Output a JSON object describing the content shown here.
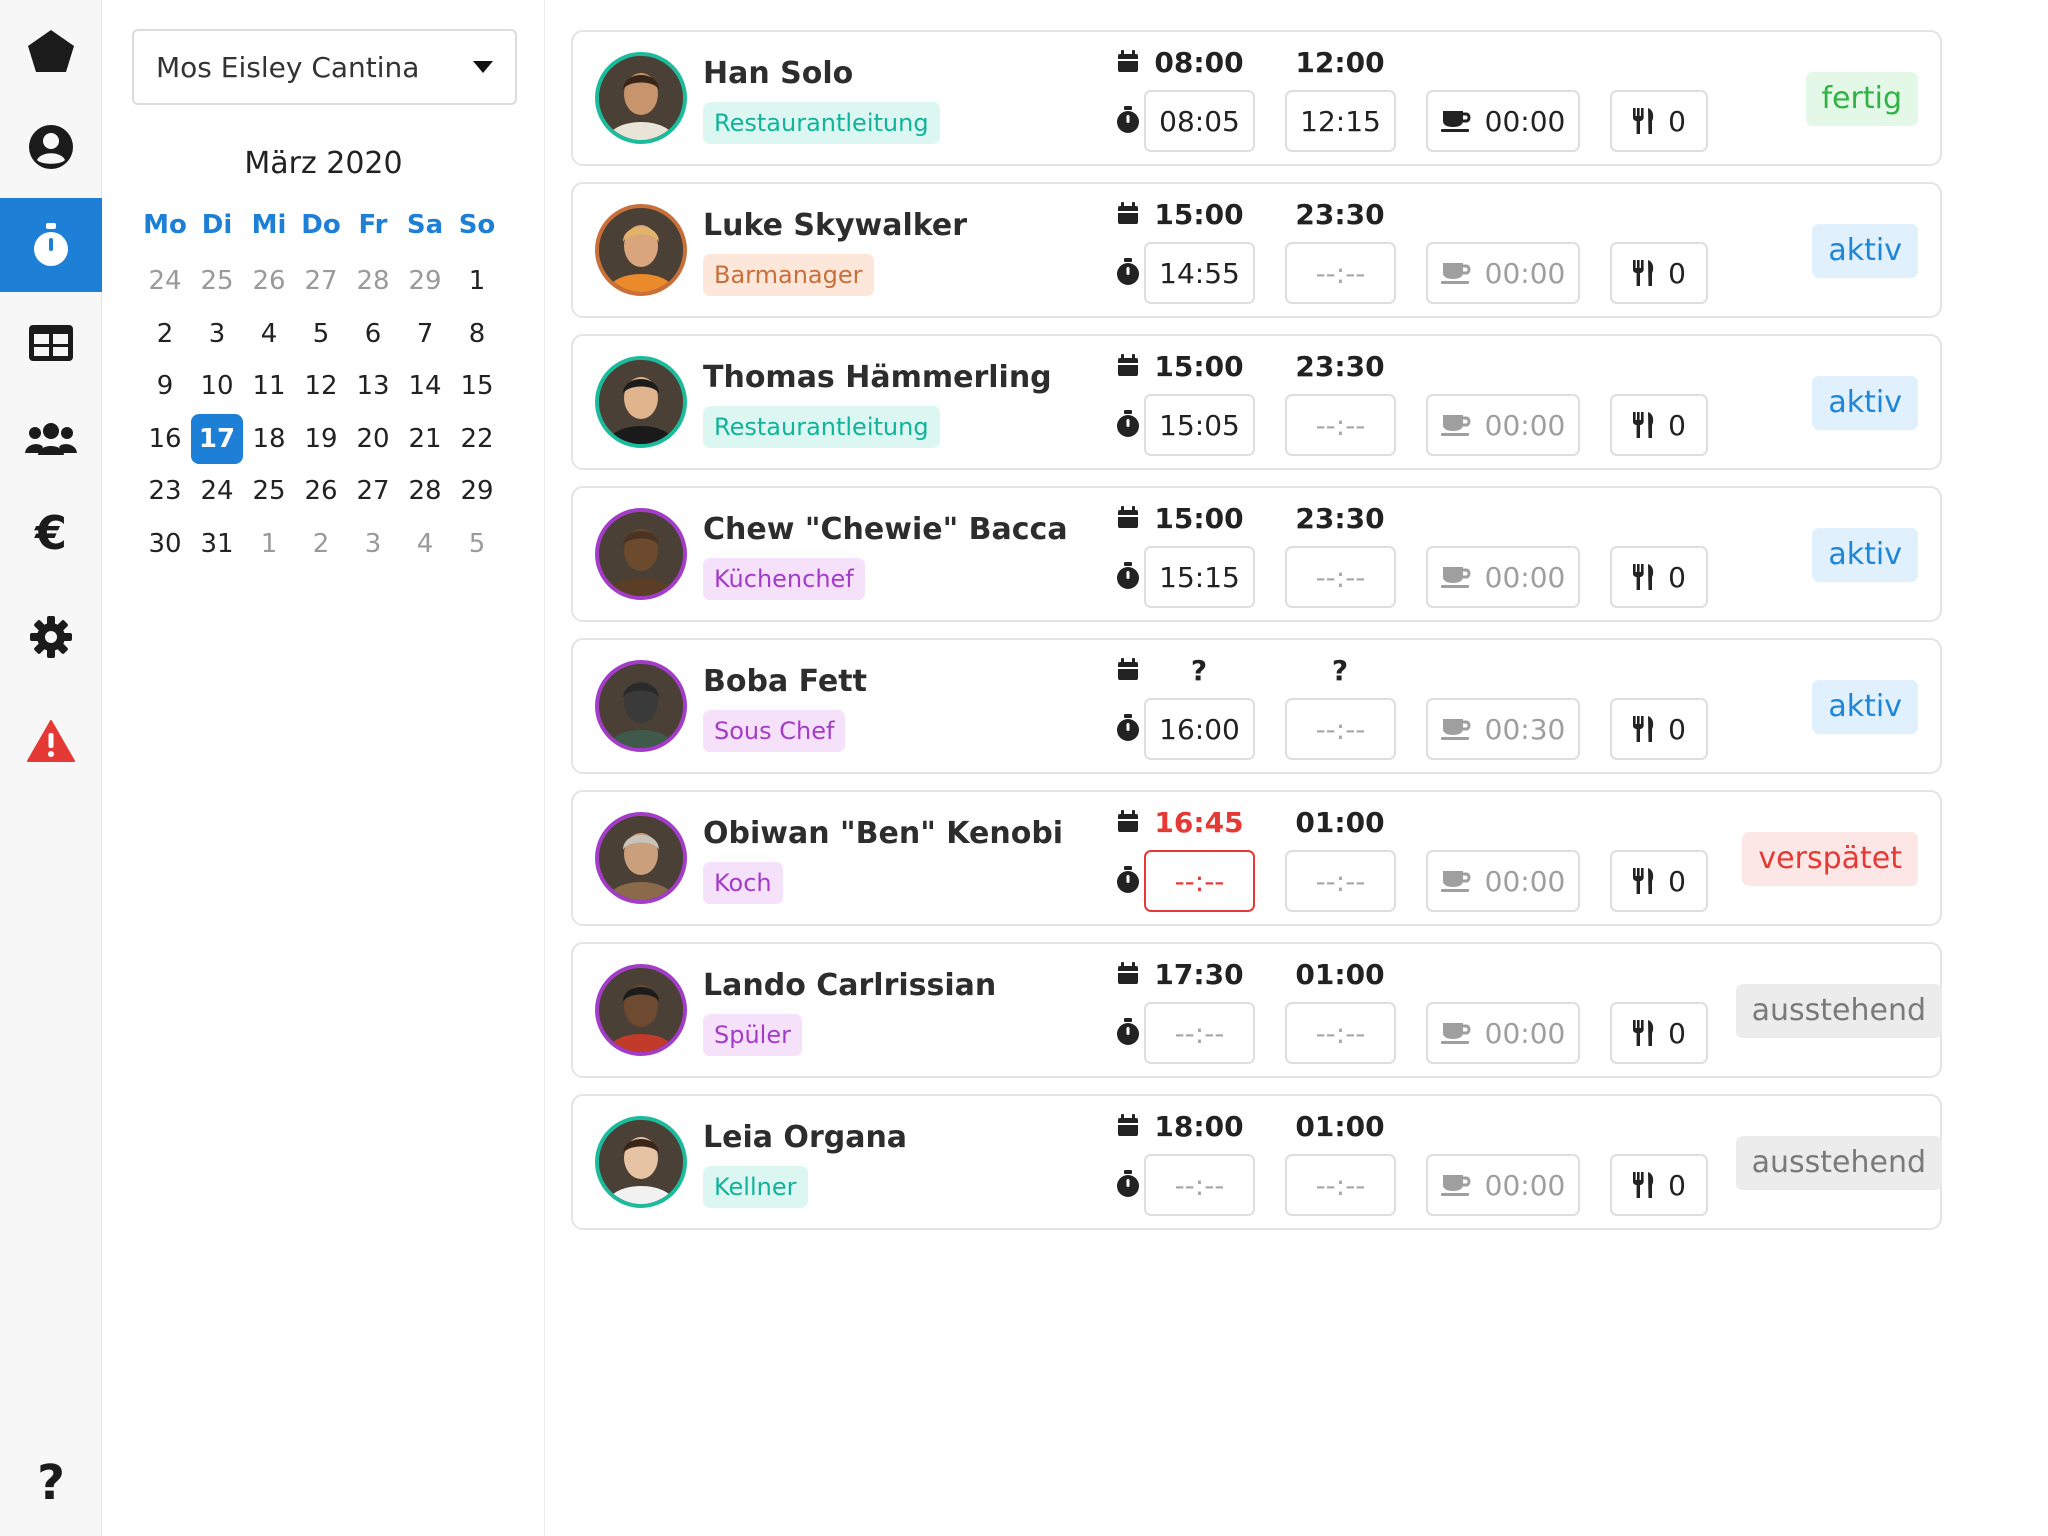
{
  "location": {
    "selected": "Mos Eisley Cantina"
  },
  "calendar": {
    "title": "März 2020",
    "weekdays": [
      "Mo",
      "Di",
      "Mi",
      "Do",
      "Fr",
      "Sa",
      "So"
    ],
    "weeks": [
      [
        "24",
        "25",
        "26",
        "27",
        "28",
        "29",
        "1"
      ],
      [
        "2",
        "3",
        "4",
        "5",
        "6",
        "7",
        "8"
      ],
      [
        "9",
        "10",
        "11",
        "12",
        "13",
        "14",
        "15"
      ],
      [
        "16",
        "17",
        "18",
        "19",
        "20",
        "21",
        "22"
      ],
      [
        "23",
        "24",
        "25",
        "26",
        "27",
        "28",
        "29"
      ],
      [
        "30",
        "31",
        "1",
        "2",
        "3",
        "4",
        "5"
      ]
    ],
    "selected_day": "17"
  },
  "sidebar": {
    "items": [
      "home-icon",
      "user-icon",
      "stopwatch-icon",
      "table-icon",
      "team-icon",
      "euro-icon",
      "gear-icon",
      "warning-icon"
    ],
    "bottom": "help-icon",
    "active": "stopwatch-icon"
  },
  "colors": {
    "accent": "#1e7fd6",
    "teal": "#1abc9c",
    "purple": "#a33cc9",
    "late": "#e53935"
  },
  "employees": [
    {
      "name": "Han Solo",
      "role": "Restaurantleitung",
      "role_color": "teal",
      "avatar_color": "teal",
      "plan_start": "08:00",
      "plan_end": "12:00",
      "actual_start": "08:05",
      "actual_end": "12:15",
      "break": "00:00",
      "meals": "0",
      "status": "fertig",
      "status_type": "done"
    },
    {
      "name": "Luke Skywalker",
      "role": "Barmanager",
      "role_color": "orange",
      "avatar_color": "orange",
      "plan_start": "15:00",
      "plan_end": "23:30",
      "actual_start": "14:55",
      "actual_end": "--:--",
      "break": "00:00",
      "meals": "0",
      "status": "aktiv",
      "status_type": "active"
    },
    {
      "name": "Thomas Hämmerling",
      "role": "Restaurantleitung",
      "role_color": "teal",
      "avatar_color": "teal",
      "plan_start": "15:00",
      "plan_end": "23:30",
      "actual_start": "15:05",
      "actual_end": "--:--",
      "break": "00:00",
      "meals": "0",
      "status": "aktiv",
      "status_type": "active"
    },
    {
      "name": "Chew \"Chewie\" Bacca",
      "role": "Küchenchef",
      "role_color": "purple",
      "avatar_color": "purple",
      "plan_start": "15:00",
      "plan_end": "23:30",
      "actual_start": "15:15",
      "actual_end": "--:--",
      "break": "00:00",
      "meals": "0",
      "status": "aktiv",
      "status_type": "active"
    },
    {
      "name": "Boba Fett",
      "role": "Sous Chef",
      "role_color": "purple",
      "avatar_color": "purple",
      "plan_start": "?",
      "plan_end": "?",
      "actual_start": "16:00",
      "actual_end": "--:--",
      "break": "00:30",
      "meals": "0",
      "status": "aktiv",
      "status_type": "active"
    },
    {
      "name": "Obiwan \"Ben\" Kenobi",
      "role": "Koch",
      "role_color": "purple",
      "avatar_color": "purple",
      "plan_start": "16:45",
      "plan_end": "01:00",
      "actual_start": "--:--",
      "actual_end": "--:--",
      "break": "00:00",
      "meals": "0",
      "status": "verspätet",
      "status_type": "late"
    },
    {
      "name": "Lando Carlrissian",
      "role": "Spüler",
      "role_color": "purple",
      "avatar_color": "purple",
      "plan_start": "17:30",
      "plan_end": "01:00",
      "actual_start": "--:--",
      "actual_end": "--:--",
      "break": "00:00",
      "meals": "0",
      "status": "ausstehend",
      "status_type": "pending"
    },
    {
      "name": "Leia Organa",
      "role": "Kellner",
      "role_color": "teal",
      "avatar_color": "teal",
      "plan_start": "18:00",
      "plan_end": "01:00",
      "actual_start": "--:--",
      "actual_end": "--:--",
      "break": "00:00",
      "meals": "0",
      "status": "ausstehend",
      "status_type": "pending"
    }
  ]
}
